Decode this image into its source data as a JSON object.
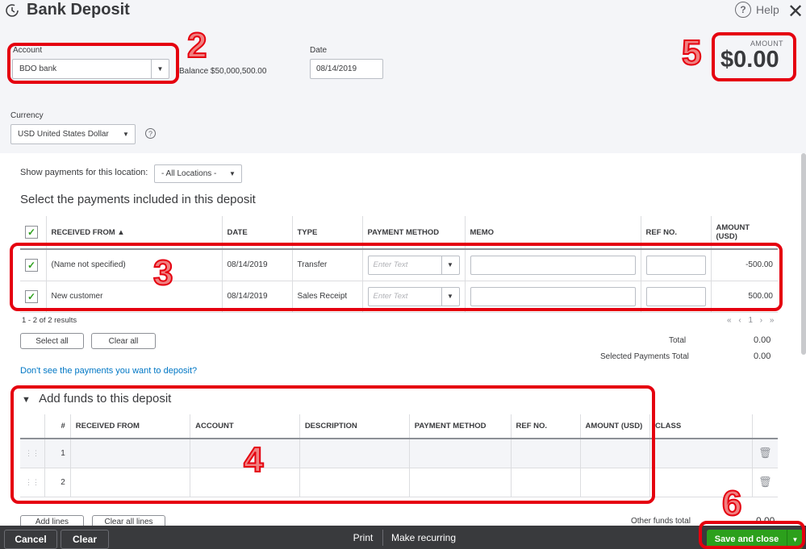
{
  "header": {
    "title": "Bank Deposit",
    "help_label": "Help"
  },
  "account": {
    "label": "Account",
    "value": "BDO bank",
    "balance": "Balance $50,000,500.00"
  },
  "date": {
    "label": "Date",
    "value": "08/14/2019"
  },
  "amount": {
    "label": "AMOUNT",
    "value": "$0.00"
  },
  "currency": {
    "label": "Currency",
    "value": "USD United States Dollar"
  },
  "location_filter": {
    "label": "Show payments for this location:",
    "value": "- All Locations -"
  },
  "payments": {
    "title": "Select the payments included in this deposit",
    "columns": [
      "RECEIVED FROM ▲",
      "DATE",
      "TYPE",
      "PAYMENT METHOD",
      "MEMO",
      "REF NO.",
      "AMOUNT (USD)"
    ],
    "rows": [
      {
        "received_from": "(Name not specified)",
        "date": "08/14/2019",
        "type": "Transfer",
        "method_placeholder": "Enter Text",
        "amount": "-500.00"
      },
      {
        "received_from": "New customer",
        "date": "08/14/2019",
        "type": "Sales Receipt",
        "method_placeholder": "Enter Text",
        "amount": "500.00"
      }
    ],
    "results": "1 - 2 of 2 results",
    "pager": "« ‹ 1 › »",
    "select_all": "Select all",
    "clear_all": "Clear all",
    "total_label": "Total",
    "total_value": "0.00",
    "selected_label": "Selected Payments Total",
    "selected_value": "0.00",
    "missing_link": "Don't see the payments you want to deposit?"
  },
  "funds": {
    "title": "Add funds to this deposit",
    "columns": [
      "#",
      "RECEIVED FROM",
      "ACCOUNT",
      "DESCRIPTION",
      "PAYMENT METHOD",
      "REF NO.",
      "AMOUNT (USD)",
      "CLASS"
    ],
    "rows": [
      {
        "num": "1"
      },
      {
        "num": "2"
      }
    ],
    "add_lines": "Add lines",
    "clear_all_lines": "Clear all lines",
    "other_total_label": "Other funds total",
    "other_total_value": "0.00"
  },
  "footer": {
    "cancel": "Cancel",
    "clear": "Clear",
    "print": "Print",
    "make_recurring": "Make recurring",
    "save_close": "Save and close"
  },
  "annotations": [
    "2",
    "3",
    "4",
    "5",
    "6"
  ],
  "colors": {
    "accent_green": "#2ca01c",
    "link_blue": "#0077c5",
    "annotation_red": "#e5000f",
    "footer_bg": "#393a3d"
  }
}
